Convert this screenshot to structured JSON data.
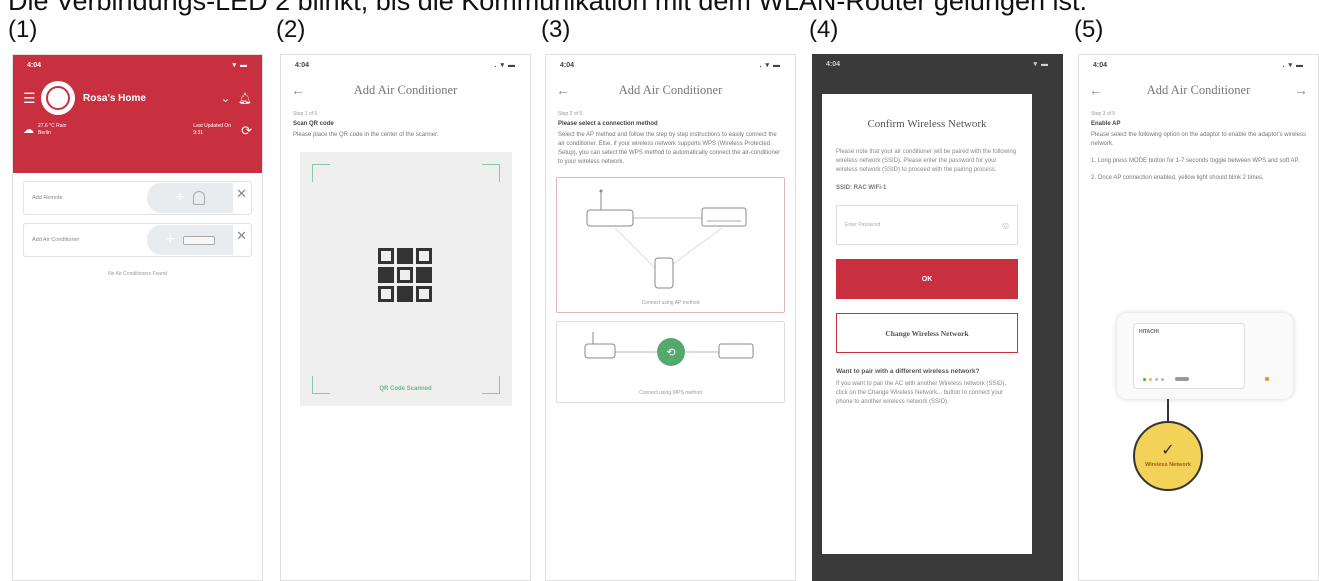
{
  "caption": "Die Verbindungs-LED 2 blinkt, bis die Kommunikation mit dem WLAN-Router gelungen ist.",
  "steps": [
    "(1)",
    "(2)",
    "(3)",
    "(4)",
    "(5)"
  ],
  "colors": {
    "brand_red": "#c9303f",
    "scan_green": "#8cc7a6",
    "wireless_yellow": "#f3d257"
  },
  "phone1": {
    "time": "4:04",
    "home_name": "Rosa's Home",
    "weather": "27.6 °C Rain\nBerlin",
    "last_updated": "Last Updated On\n9:31",
    "cards": [
      {
        "label": "Add Remote"
      },
      {
        "label": "Add Air Conditioner"
      }
    ],
    "empty_text": "No Air Conditioners Found"
  },
  "phone2": {
    "time": "4:04",
    "title": "Add Air Conditioner",
    "step": "Step 1 of 5",
    "section_title": "Scan QR code",
    "body": "Please place the QR code in the center of the scanner.",
    "scanned_text": "QR Code Scanned"
  },
  "phone3": {
    "time": "4:04",
    "title": "Add Air Conditioner",
    "step": "Step 2 of 5",
    "section_title": "Please select a connection method",
    "body": "Select the AP method and follow the step by step instructions to easily connect the air conditioner. Else, if your wireless network supports WPS (Wireless Protected Setup), you can select the WPS method to automatically connect the air-conditioner to your wireless network.",
    "method_ap": "Connect using AP method",
    "method_wps": "Connect using WPS method"
  },
  "phone4": {
    "time": "4:04",
    "dialog_title": "Confirm Wireless Network",
    "body": "Please note that your air conditioner will be paired with the following wireless network (SSID). Please enter the password for your wireless network (SSID) to proceed with the pairing process.",
    "ssid": "SSID: RAC WiFi-1",
    "password_placeholder": "Enter Password",
    "ok_label": "OK",
    "change_label": "Change Wireless Network",
    "pair_title": "Want to pair with a different wireless network?",
    "pair_body": "If you want to pair the AC with another Wireless network (SSID), click on the Change Wireless Network... button to connect your phone to another wireless network (SSID)."
  },
  "phone5": {
    "time": "4:04",
    "title": "Add Air Conditioner",
    "step": "Step 3 of 5",
    "section_title": "Enable AP",
    "body": "Please select the following option on the adaptor to enable the adaptor's wireless network.",
    "instruction1": "1. Long press MODE button for 1-7 seconds toggle between WPS and soft AP.",
    "instruction2": "2. Once AP connection enabled, yellow light should blink 2 times.",
    "brand": "HITACHI",
    "badge_label": "Wireless Network"
  }
}
